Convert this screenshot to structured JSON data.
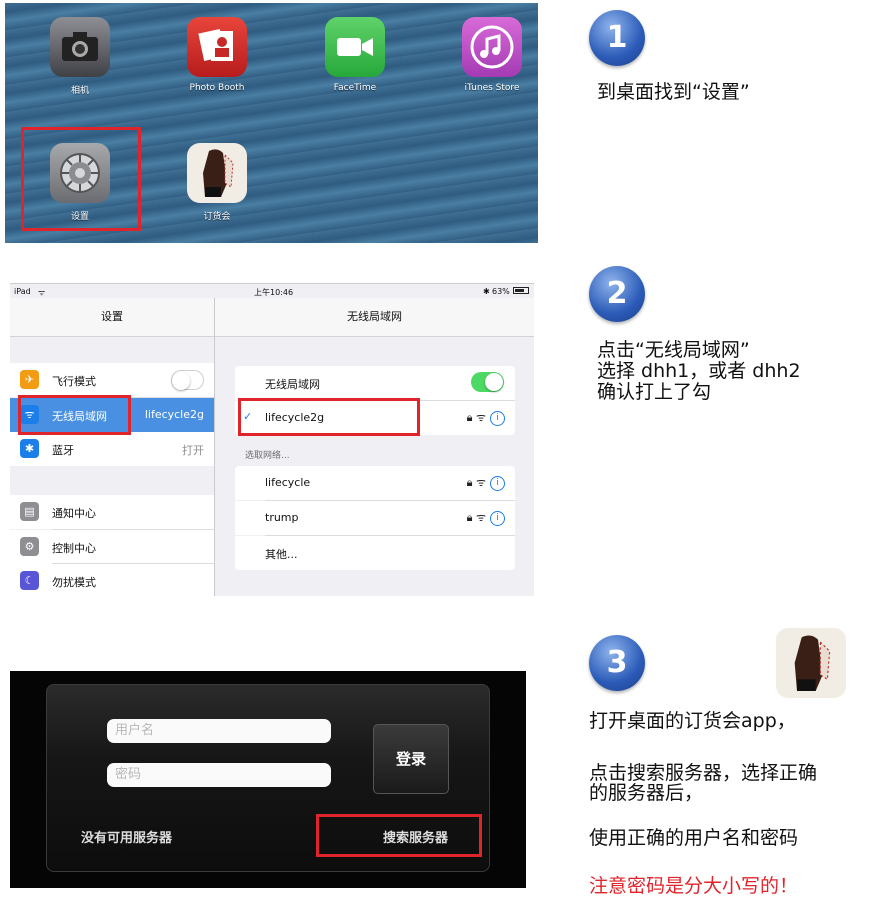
{
  "home": {
    "apps": [
      {
        "label": "相机",
        "icon": "camera-icon"
      },
      {
        "label": "Photo Booth",
        "icon": "photo-booth-icon"
      },
      {
        "label": "FaceTime",
        "icon": "facetime-icon"
      },
      {
        "label": "iTunes Store",
        "icon": "itunes-icon"
      },
      {
        "label": "设置",
        "icon": "settings-gear-icon"
      },
      {
        "label": "订货会",
        "icon": "order-fair-app-icon"
      }
    ]
  },
  "ipad": {
    "status": {
      "device": "iPad",
      "time": "上午10:46",
      "battery": "63%"
    },
    "left_title": "设置",
    "right_title": "无线局域网",
    "left_rows": [
      {
        "label": "飞行模式",
        "value": ""
      },
      {
        "label": "无线局域网",
        "value": "lifecycle2g"
      },
      {
        "label": "蓝牙",
        "value": "打开"
      },
      {
        "label": "通知中心",
        "value": ""
      },
      {
        "label": "控制中心",
        "value": ""
      },
      {
        "label": "勿扰模式",
        "value": ""
      }
    ],
    "wifi_toggle_label": "无线局域网",
    "connected": "lifecycle2g",
    "choose_label": "选取网络...",
    "networks": [
      "lifecycle",
      "trump"
    ],
    "other": "其他..."
  },
  "login": {
    "username_placeholder": "用户名",
    "password_placeholder": "密码",
    "login_button": "登录",
    "no_server": "没有可用服务器",
    "search_server": "搜索服务器"
  },
  "steps": [
    {
      "num": "1",
      "lines": [
        "到桌面找到“设置”"
      ]
    },
    {
      "num": "2",
      "lines": [
        "点击“无线局域网”",
        "选择 dhh1，或者 dhh2",
        "确认打上了勾"
      ]
    },
    {
      "num": "3",
      "lines": [
        "打开桌面的订货会app，",
        "点击搜索服务器，选择正确",
        "的服务器后，",
        "使用正确的用户名和密码",
        "注意密码是分大小写的！"
      ]
    }
  ],
  "colors": {
    "highlight": "#e0242b",
    "ios_blue": "#1c7ee8",
    "toggle_on": "#4cd964",
    "warning": "#e0242b"
  }
}
